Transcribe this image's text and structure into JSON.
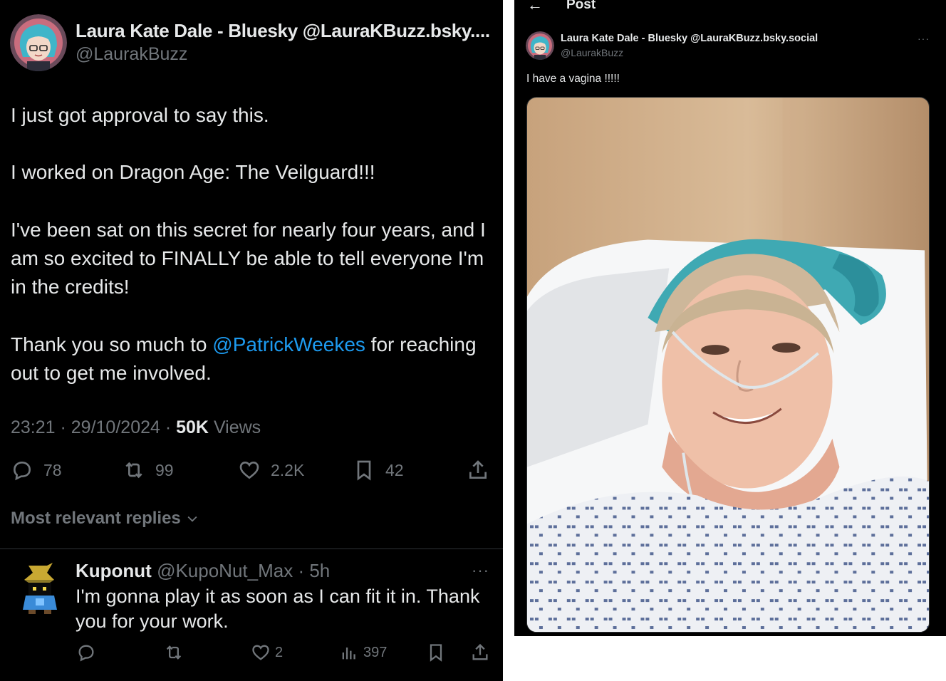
{
  "left_tweet": {
    "author_name": "Laura Kate Dale - Bluesky @LauraKBuzz.bsky....",
    "author_handle": "@LaurakBuzz",
    "paragraphs": [
      "I just got approval to say this.",
      "I worked on Dragon Age: The Veilguard!!!",
      "I've been sat on this secret for nearly four years, and I am so excited to FINALLY be able to tell everyone I'm in the credits!"
    ],
    "thanks_before": "Thank you so much to ",
    "mention": "@PatrickWeekes",
    "thanks_after": " for reaching out to get me involved.",
    "time": "23:21 · 29/10/2024 · ",
    "views_count": "50K",
    "views_label": " Views",
    "actions": {
      "replies": "78",
      "reposts": "99",
      "likes": "2.2K",
      "bookmarks": "42"
    },
    "replies_sort_label": "Most relevant replies"
  },
  "reply": {
    "name": "Kuponut",
    "handle_time": " @KupoNut_Max · 5h",
    "more": "···",
    "text": "I'm gonna play it as soon as I can fit it in. Thank you for your work.",
    "actions": {
      "likes": "2",
      "views": "397"
    }
  },
  "right_post": {
    "back_icon": "←",
    "header_title": "Post",
    "author_name": "Laura Kate Dale - Bluesky @LauraKBuzz.bsky.social",
    "author_handle": "@LaurakBuzz",
    "more": "···",
    "text": "I have a vagina !!!!!"
  },
  "colors": {
    "background": "#000000",
    "text": "#e7e9ea",
    "muted": "#71767b",
    "link": "#1d9bf0",
    "divider": "#2f3336"
  }
}
